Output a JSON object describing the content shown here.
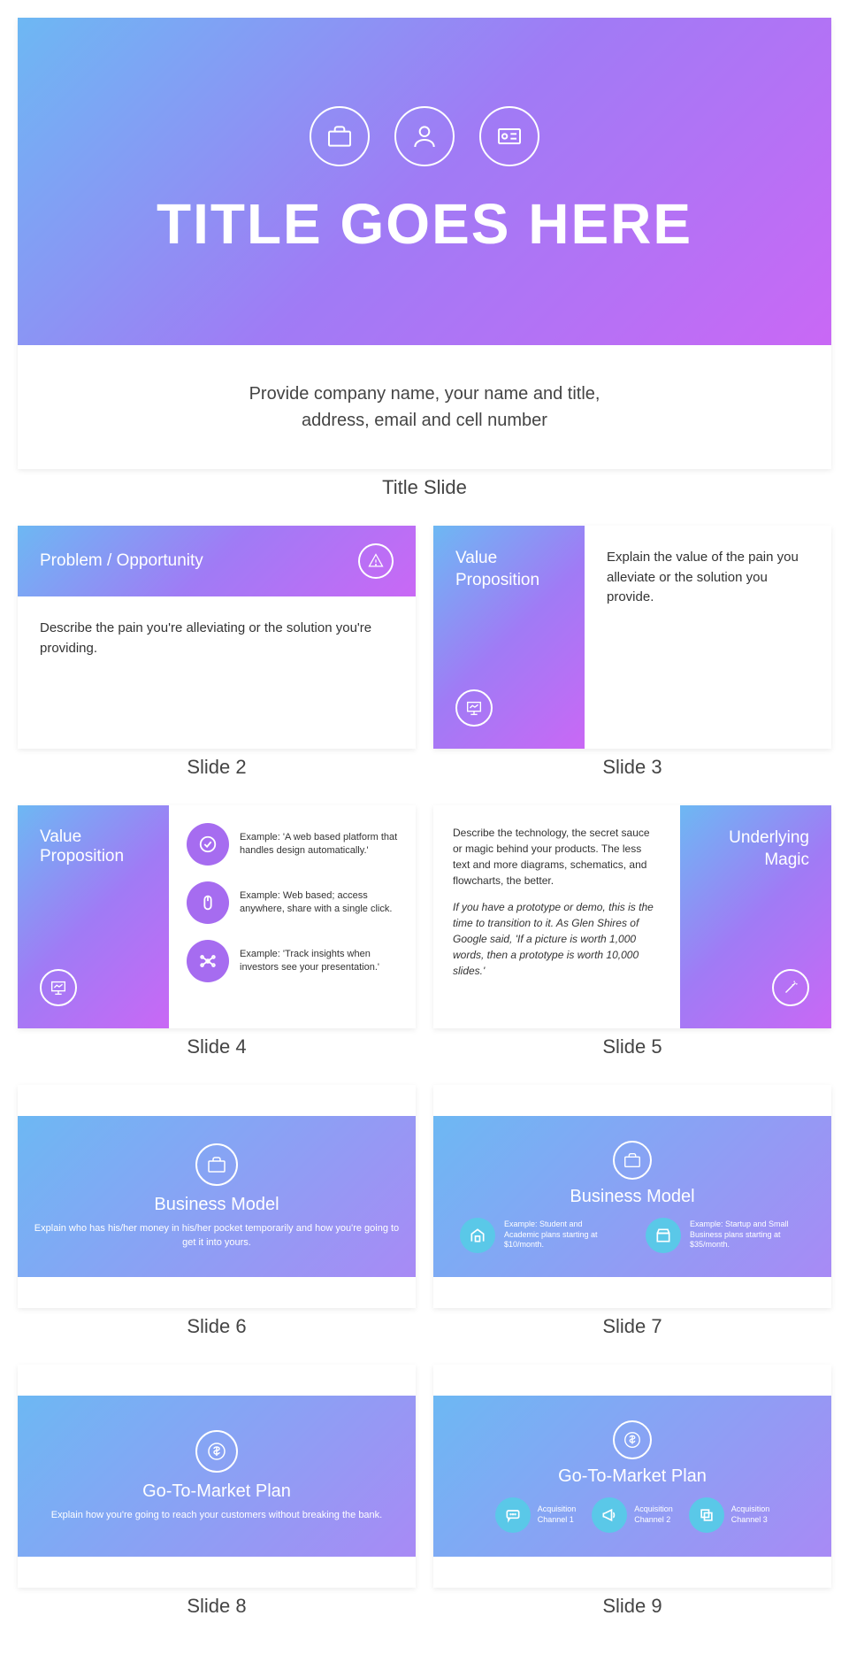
{
  "title": {
    "main": "TITLE GOES HERE",
    "sub": "Provide company name, your name and title,\naddress, email and cell number",
    "label": "Title Slide"
  },
  "s2": {
    "title": "Problem / Opportunity",
    "body": "Describe the pain you're alleviating or the solution you're providing.",
    "label": "Slide 2"
  },
  "s3": {
    "title": "Value\nProposition",
    "body": "Explain the value of the pain you alleviate or the solution you provide.",
    "label": "Slide 3"
  },
  "s4": {
    "title": "Value\nProposition",
    "i1": "Example: 'A web based platform that handles design automatically.'",
    "i2": "Example: Web based; access anywhere, share with a single click.",
    "i3": "Example: 'Track insights when investors see your presentation.'",
    "label": "Slide 4"
  },
  "s5": {
    "p1": "Describe the technology, the secret sauce or magic behind your products. The less text and more diagrams, schematics, and flowcharts, the better.",
    "p2": "If you have a prototype or demo, this is the time to transition to it. As Glen Shires of Google said, 'If a picture is worth 1,000 words, then a prototype is worth 10,000 slides.'",
    "title": "Underlying\nMagic",
    "label": "Slide 5"
  },
  "s6": {
    "title": "Business Model",
    "d": "Explain who has his/her money in his/her pocket temporarily and how you're going to get it into yours.",
    "label": "Slide 6"
  },
  "s7": {
    "title": "Business Model",
    "i1": "Example: Student and Academic plans starting at $10/month.",
    "i2": "Example: Startup and Small Business plans starting at $35/month.",
    "label": "Slide 7"
  },
  "s8": {
    "title": "Go-To-Market Plan",
    "d": "Explain how you're going to reach your customers without breaking the bank.",
    "label": "Slide 8"
  },
  "s9": {
    "title": "Go-To-Market Plan",
    "a1": "Acquisition\nChannel 1",
    "a2": "Acquisition\nChannel 2",
    "a3": "Acquisition\nChannel 3",
    "label": "Slide 9"
  }
}
